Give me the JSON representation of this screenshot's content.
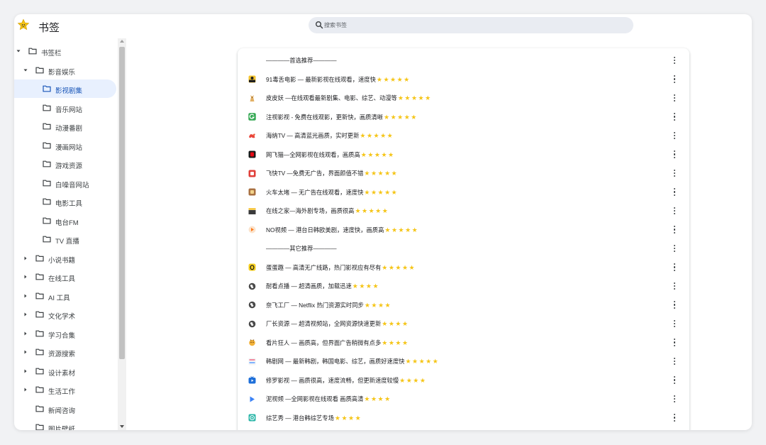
{
  "app": {
    "title": "书签"
  },
  "search": {
    "placeholder": "搜索书签"
  },
  "sidebar": {
    "items": [
      {
        "label": "书签栏",
        "level": 0,
        "caret": "expanded"
      },
      {
        "label": "影音娱乐",
        "level": 1,
        "caret": "expanded"
      },
      {
        "label": "影视剧集",
        "level": 2,
        "caret": "none",
        "selected": true
      },
      {
        "label": "音乐网站",
        "level": 2,
        "caret": "none"
      },
      {
        "label": "动漫番剧",
        "level": 2,
        "caret": "none"
      },
      {
        "label": "漫画网站",
        "level": 2,
        "caret": "none"
      },
      {
        "label": "游戏资源",
        "level": 2,
        "caret": "none"
      },
      {
        "label": "白噪音网站",
        "level": 2,
        "caret": "none"
      },
      {
        "label": "电影工具",
        "level": 2,
        "caret": "none"
      },
      {
        "label": "电台FM",
        "level": 2,
        "caret": "none"
      },
      {
        "label": "TV 直播",
        "level": 2,
        "caret": "none"
      },
      {
        "label": "小说书籍",
        "level": 1,
        "caret": "collapsed"
      },
      {
        "label": "在线工具",
        "level": 1,
        "caret": "collapsed"
      },
      {
        "label": "AI 工具",
        "level": 1,
        "caret": "collapsed"
      },
      {
        "label": "文化学术",
        "level": 1,
        "caret": "collapsed"
      },
      {
        "label": "学习合集",
        "level": 1,
        "caret": "collapsed"
      },
      {
        "label": "资源搜索",
        "level": 1,
        "caret": "collapsed"
      },
      {
        "label": "设计素材",
        "level": 1,
        "caret": "collapsed"
      },
      {
        "label": "生活工作",
        "level": 1,
        "caret": "collapsed"
      },
      {
        "label": "新闻咨询",
        "level": 1,
        "caret": "none"
      },
      {
        "label": "图片壁纸",
        "level": 1,
        "caret": "none"
      }
    ]
  },
  "bookmarks": [
    {
      "kind": "separator",
      "title": "————首选推荐————"
    },
    {
      "kind": "link",
      "title": "91毒舌电影 — 最新影视在线观看，速度快",
      "stars": 5,
      "icon": "black-yellow-face-icon",
      "icon_color": "#1f1f1f",
      "icon_accent": "#f4c430"
    },
    {
      "kind": "link",
      "title": "皮皮妖 —在线观看最新剧集、电影、综艺、动漫等",
      "stars": 5,
      "icon": "tan-figure-icon",
      "icon_color": "#e2b065",
      "icon_accent": "#9a6a2f"
    },
    {
      "kind": "link",
      "title": "注视影视 - 免费在线观影，更新快，画质清晰",
      "stars": 5,
      "icon": "green-g-icon",
      "icon_color": "#34a853",
      "icon_accent": "#ffffff"
    },
    {
      "kind": "link",
      "title": "海纳TV — 高清蓝光画质，实时更新",
      "stars": 5,
      "icon": "red-bird-icon",
      "icon_color": "#e8453c",
      "icon_accent": "#ff9d42"
    },
    {
      "kind": "link",
      "title": "网飞猫—全网影视在线观看，画质高",
      "stars": 5,
      "icon": "black-red-icon",
      "icon_color": "#1a1a1a",
      "icon_accent": "#e50914"
    },
    {
      "kind": "link",
      "title": "飞快TV —免费无广告，界面颜值不错",
      "stars": 5,
      "icon": "red-square-icon",
      "icon_color": "#e0403a",
      "icon_accent": "#ffffff"
    },
    {
      "kind": "link",
      "title": "火车太堵 — 无广告在线观看，速度快",
      "stars": 5,
      "icon": "brown-tile-icon",
      "icon_color": "#a97142",
      "icon_accent": "#f2d38a"
    },
    {
      "kind": "link",
      "title": "在线之家—海外剧专场，画质很高",
      "stars": 5,
      "icon": "film-clapper-icon",
      "icon_color": "#3a3a3a",
      "icon_accent": "#f4b400"
    },
    {
      "kind": "link",
      "title": "NO视频 — 港台日韩欧美剧，速度快，画质高",
      "stars": 5,
      "icon": "orange-play-icon",
      "icon_color": "#fbe3cc",
      "icon_accent": "#ff7a1a"
    },
    {
      "kind": "separator",
      "title": "————其它推荐————"
    },
    {
      "kind": "link",
      "title": "蛋蛋趣 — 高清无广线路，热门影视应有尽有",
      "stars": 5,
      "icon": "yellow-egg-icon",
      "icon_color": "#f6cf1f",
      "icon_accent": "#1a1a1a"
    },
    {
      "kind": "link",
      "title": "耐看点播 — 超清画质，加载迅速",
      "stars": 4,
      "icon": "globe-icon",
      "icon_color": "#4a4a4a",
      "icon_accent": "#ffffff"
    },
    {
      "kind": "link",
      "title": "奈飞工厂 — Netflix 热门资源实时同步",
      "stars": 4,
      "icon": "globe-icon",
      "icon_color": "#4a4a4a",
      "icon_accent": "#ffffff"
    },
    {
      "kind": "link",
      "title": "厂长资源 — 超清视频站，全网资源快速更新",
      "stars": 4,
      "icon": "globe-icon",
      "icon_color": "#4a4a4a",
      "icon_accent": "#ffffff"
    },
    {
      "kind": "link",
      "title": "看片狂人 — 画质高，但界面广告稍微有点多",
      "stars": 4,
      "icon": "cartoon-face-icon",
      "icon_color": "#f2b23a",
      "icon_accent": "#7a4a14"
    },
    {
      "kind": "link",
      "title": "韩剧网 — 最新韩剧，韩国电影、综艺，画质好速度快",
      "stars": 5,
      "icon": "striped-tile-icon",
      "icon_color": "#f08aa0",
      "icon_accent": "#7fb3ff"
    },
    {
      "kind": "link",
      "title": "修罗影视 — 画质很高，速度流畅，但更新速度较慢",
      "stars": 4,
      "icon": "blue-tv-icon",
      "icon_color": "#1e6fd9",
      "icon_accent": "#ffffff"
    },
    {
      "kind": "link",
      "title": "泥视频 —全网影视在线观看 画质高清",
      "stars": 4,
      "icon": "blue-play-icon",
      "icon_color": "#3b82f6",
      "icon_accent": "#ffffff"
    },
    {
      "kind": "link",
      "title": "综艺秀 — 港台韩综艺专场",
      "stars": 4,
      "icon": "teal-face-icon",
      "icon_color": "#2bb6a8",
      "icon_accent": "#ffffff"
    }
  ],
  "colors": {
    "selected_bg": "#e8f0fe",
    "star": "#f5c518",
    "search_bg": "#e9ecf2"
  }
}
